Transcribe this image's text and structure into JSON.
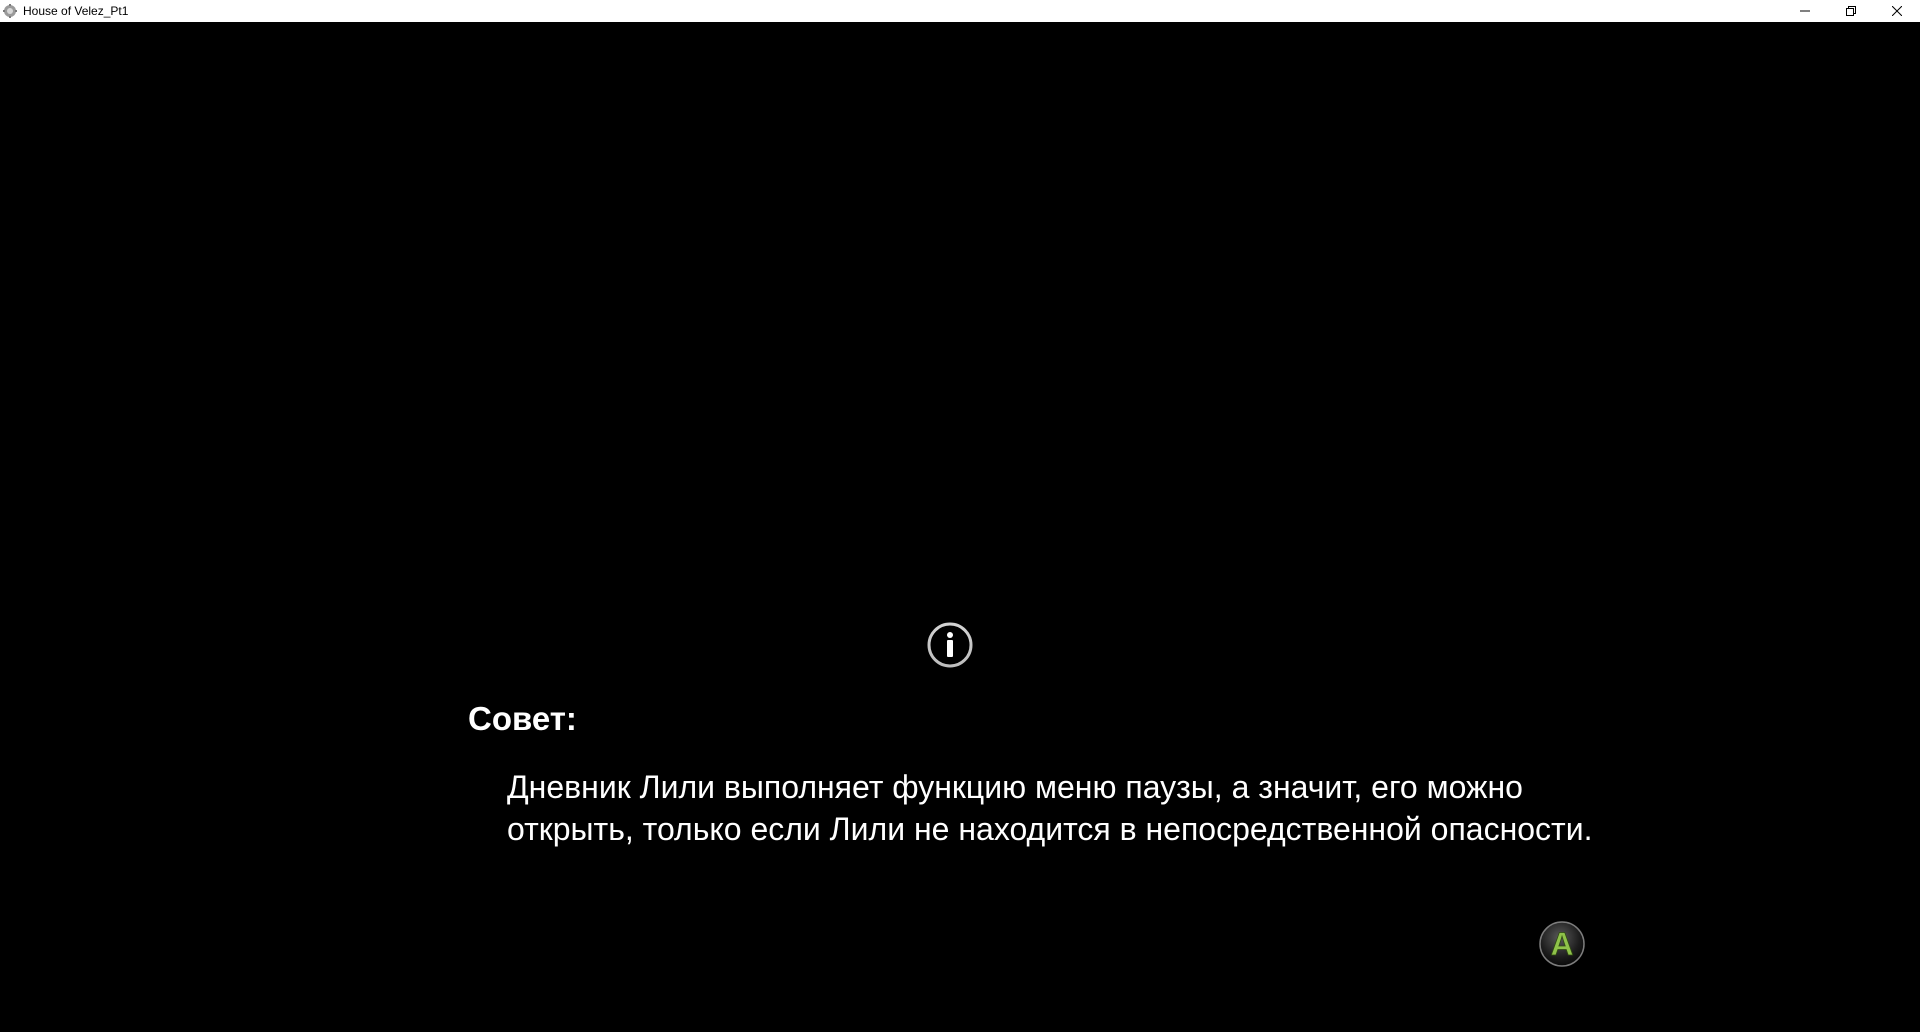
{
  "window": {
    "title": "House of Velez_Pt1",
    "app_icon": "gear-app-icon",
    "controls": {
      "minimize_icon": "minimize-icon",
      "restore_icon": "restore-icon",
      "close_icon": "close-icon"
    }
  },
  "tip": {
    "icon": "info-icon",
    "heading": "Совет:",
    "body": "Дневник Лили выполняет функцию меню паузы, а значит, его можно открыть, только если Лили не находится в непосредственной опасности.",
    "continue_button": {
      "label": "A",
      "icon": "a-button-icon",
      "color": "#8fc24a"
    }
  }
}
